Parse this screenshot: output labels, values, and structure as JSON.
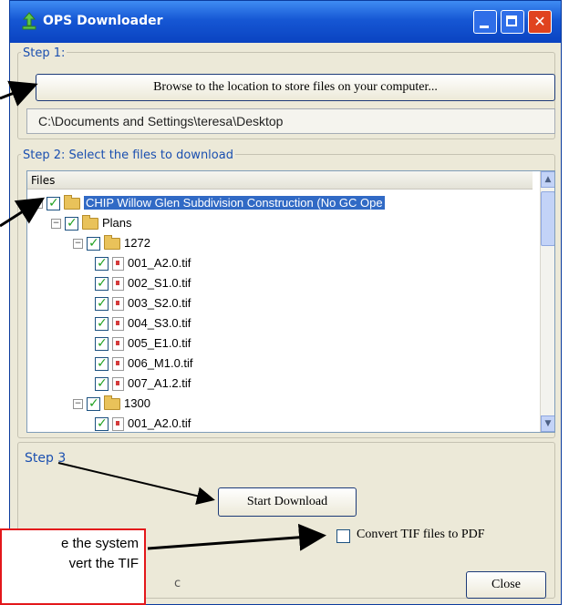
{
  "window": {
    "title": "OPS Downloader"
  },
  "step1": {
    "label": "Step 1:",
    "browse_button": "Browse to the location to store files on your computer...",
    "path_value": "C:\\Documents and Settings\\teresa\\Desktop"
  },
  "step2": {
    "label": "Step 2: Select the files to download",
    "column_header": "Files",
    "tree": [
      {
        "label": "CHIP Willow Glen Subdivision Construction (No GC Ope",
        "type": "folder",
        "expander": "−",
        "checked": true,
        "selected": true
      },
      {
        "label": "Plans",
        "type": "folder",
        "expander": "−",
        "checked": true
      },
      {
        "label": "1272",
        "type": "folder",
        "expander": "−",
        "checked": true
      },
      {
        "label": "001_A2.0.tif",
        "type": "file",
        "checked": true
      },
      {
        "label": "002_S1.0.tif",
        "type": "file",
        "checked": true
      },
      {
        "label": "003_S2.0.tif",
        "type": "file",
        "checked": true
      },
      {
        "label": "004_S3.0.tif",
        "type": "file",
        "checked": true
      },
      {
        "label": "005_E1.0.tif",
        "type": "file",
        "checked": true
      },
      {
        "label": "006_M1.0.tif",
        "type": "file",
        "checked": true
      },
      {
        "label": "007_A1.2.tif",
        "type": "file",
        "checked": true
      },
      {
        "label": "1300",
        "type": "folder",
        "expander": "−",
        "checked": true
      },
      {
        "label": "001_A2.0.tif",
        "type": "file",
        "checked": true
      }
    ]
  },
  "step3": {
    "label": "Step 3",
    "start_button": "Start Download",
    "convert_checkbox_label": "Convert TIF files to PDF",
    "convert_checked": false,
    "close_button": "Close",
    "partial_text": "c"
  },
  "callout": {
    "line1": "e the system",
    "line2": "vert the TIF"
  },
  "colors": {
    "title_bar": "#1657d4",
    "selection": "#316ac5",
    "callout_border": "#e3171b",
    "group_label": "#1a4fb0"
  }
}
